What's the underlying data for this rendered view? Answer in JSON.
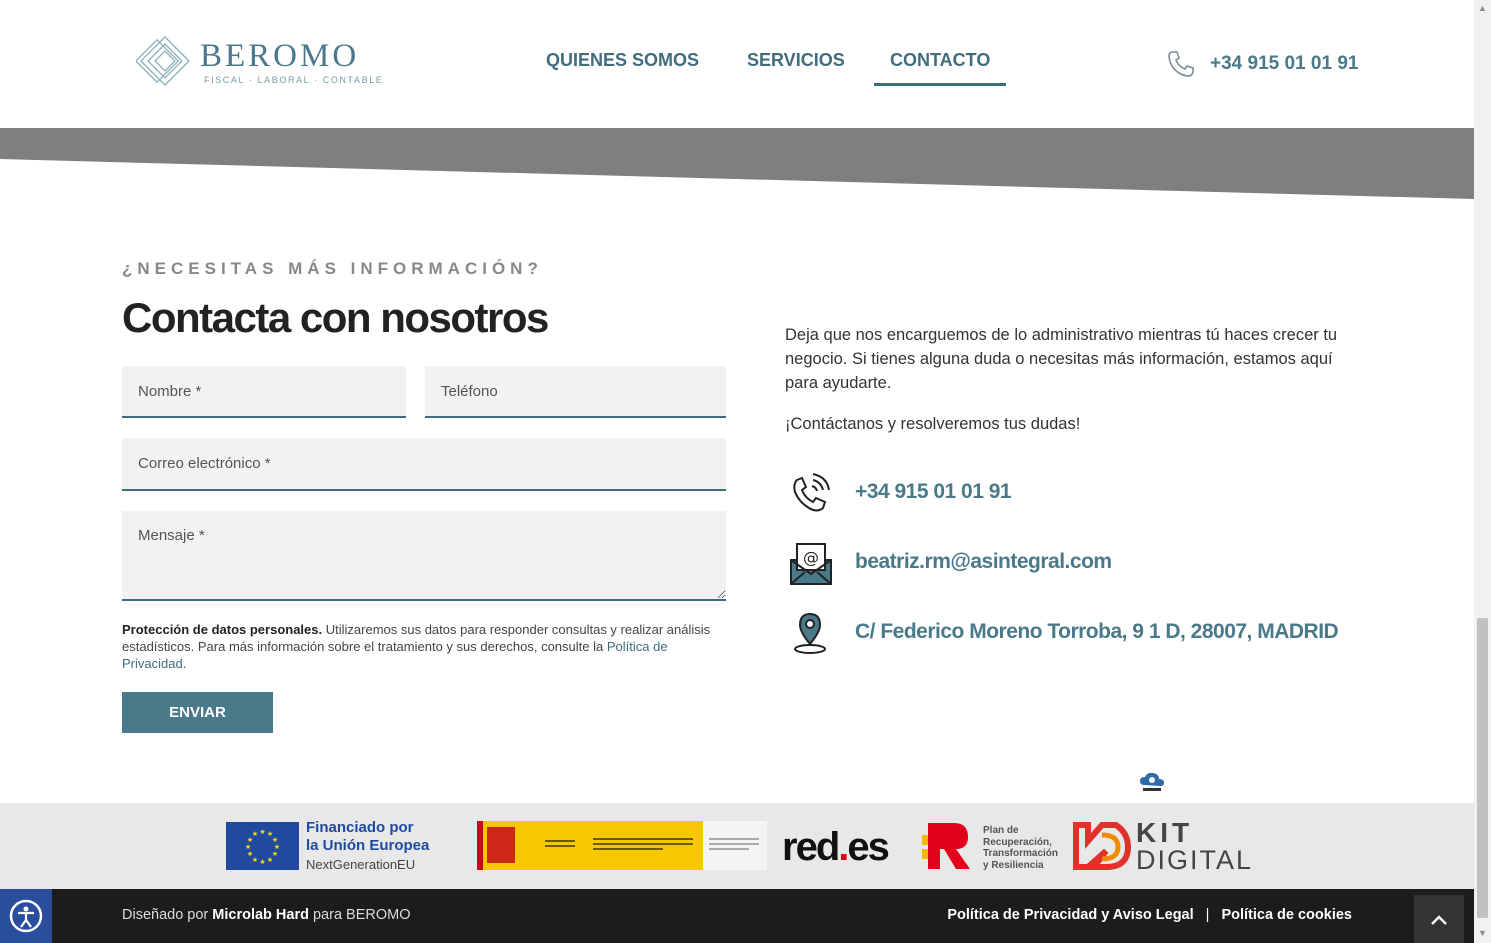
{
  "header": {
    "logo": {
      "name": "BEROMO",
      "tagline": "FISCAL · LABORAL · CONTABLE"
    },
    "nav": [
      {
        "label": "QUIENES SOMOS",
        "active": false
      },
      {
        "label": "SERVICIOS",
        "active": false
      },
      {
        "label": "CONTACTO",
        "active": true
      }
    ],
    "phone": "+34 915 01 01 91"
  },
  "contact": {
    "eyebrow": "¿NECESITAS MÁS INFORMACIÓN?",
    "title": "Contacta con nosotros",
    "form": {
      "name_placeholder": "Nombre *",
      "phone_placeholder": "Teléfono",
      "email_placeholder": "Correo electrónico *",
      "message_placeholder": "Mensaje *",
      "privacy_bold": "Protección de datos personales.",
      "privacy_text": " Utilizaremos sus datos para responder consultas y realizar análisis estadísticos. Para más información sobre el tratamiento y sus derechos, consulte la ",
      "privacy_link": "Política de Privacidad",
      "privacy_end": ".",
      "submit_label": "ENVIAR"
    },
    "description": "Deja que nos encarguemos de lo administrativo mientras tú haces crecer tu negocio. Si tienes alguna duda o necesitas más información, estamos aquí para ayudarte.",
    "cta": "¡Contáctanos y resolveremos tus dudas!",
    "phone": "+34 915 01 01 91",
    "email": "beatriz.rm@asintegral.com",
    "address": "C/ Federico Moreno Torroba, 9 1 D, 28007, MADRID"
  },
  "sponsors": {
    "eu_line1": "Financiado por",
    "eu_line2": "la Unión Europea",
    "eu_line3": "NextGenerationEU",
    "redes_a": "red",
    "redes_dot": ".",
    "redes_b": "es",
    "prtr_lines": [
      "Plan de",
      "Recuperación,",
      "Transformación",
      "y Resiliencia"
    ],
    "kit_line1": "KIT",
    "kit_line2": "DIGITAL"
  },
  "footer": {
    "credit_prefix": "Diseñado por ",
    "credit_company": "Microlab Hard",
    "credit_suffix": " para BEROMO",
    "link_privacy": "Política de Privacidad y Aviso Legal",
    "separator": "|",
    "link_cookies": "Política de cookies"
  },
  "colors": {
    "accent": "#4a7a8a",
    "nav": "#3f6d7d",
    "band": "#7f7f7f",
    "footer_bg": "#1c1c1c"
  }
}
